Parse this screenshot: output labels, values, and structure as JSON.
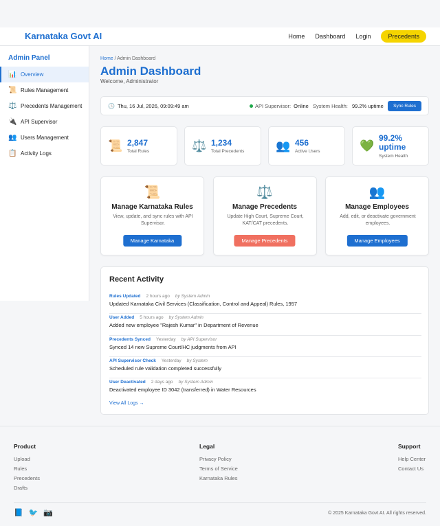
{
  "brand": "Karnataka Govt AI",
  "nav": {
    "links": [
      "Home",
      "Dashboard",
      "Login"
    ],
    "cta": "Precedents"
  },
  "sidebar": {
    "title": "Admin Panel",
    "items": [
      {
        "icon": "📊",
        "label": "Overview"
      },
      {
        "icon": "📜",
        "label": "Rules Management"
      },
      {
        "icon": "⚖️",
        "label": "Precedents Management"
      },
      {
        "icon": "🔌",
        "label": "API Supervisor"
      },
      {
        "icon": "👥",
        "label": "Users Management"
      },
      {
        "icon": "📋",
        "label": "Activity Logs"
      }
    ]
  },
  "breadcrumb": {
    "home": "Home",
    "sep": "/",
    "current": "Admin Dashboard"
  },
  "page": {
    "title": "Admin Dashboard",
    "welcome": "Welcome, Administrator"
  },
  "status": {
    "clock_icon": "🕒",
    "datetime": "Thu, 16 Jul, 2026, 09:09:49 am",
    "api_label": "API Supervisor:",
    "api_value": "Online",
    "health_label": "System Health:",
    "health_value": "99.2% uptime",
    "sync_label": "Sync Rules"
  },
  "stats": [
    {
      "icon": "📜",
      "value": "2,847",
      "label": "Total Rules"
    },
    {
      "icon": "⚖️",
      "value": "1,234",
      "label": "Total Precedents"
    },
    {
      "icon": "👥",
      "value": "456",
      "label": "Active Users"
    },
    {
      "icon": "💚",
      "value": "99.2% uptime",
      "label": "System Health"
    }
  ],
  "cards": [
    {
      "icon": "📜",
      "title": "Manage Karnataka Rules",
      "desc": "View, update, and sync rules with API Supervisor.",
      "button": "Manage Karnataka"
    },
    {
      "icon": "⚖️",
      "title": "Manage Precedents",
      "desc": "Update High Court, Supreme Court, KAT/CAT precedents.",
      "button": "Manage Precedents"
    },
    {
      "icon": "👥",
      "title": "Manage Employees",
      "desc": "Add, edit, or deactivate government employees.",
      "button": "Manage Employees"
    }
  ],
  "activity": {
    "title": "Recent Activity",
    "items": [
      {
        "type": "Rules Updated",
        "time": "2 hours ago",
        "by": "by System Admin",
        "desc": "Updated Karnataka Civil Services (Classification, Control and Appeal) Rules, 1957"
      },
      {
        "type": "User Added",
        "time": "5 hours ago",
        "by": "by System Admin",
        "desc": "Added new employee \"Rajesh Kumar\" in Department of Revenue"
      },
      {
        "type": "Precedents Synced",
        "time": "Yesterday",
        "by": "by API Supervisor",
        "desc": "Synced 14 new Supreme Court/HC judgments from API"
      },
      {
        "type": "API Supervisor Check",
        "time": "Yesterday",
        "by": "by System",
        "desc": "Scheduled rule validation completed successfully"
      },
      {
        "type": "User Deactivated",
        "time": "2 days ago",
        "by": "by System Admin",
        "desc": "Deactivated employee ID 3042 (transferred) in Water Resources"
      }
    ],
    "view_all": "View All Logs →"
  },
  "footer": {
    "product": {
      "title": "Product",
      "links": [
        "Upload",
        "Rules",
        "Precedents",
        "Drafts"
      ]
    },
    "legal": {
      "title": "Legal",
      "links": [
        "Privacy Policy",
        "Terms of Service",
        "Karnataka Rules"
      ]
    },
    "support": {
      "title": "Support",
      "links": [
        "Help Center",
        "Contact Us"
      ]
    },
    "socials": [
      "📘",
      "🐦",
      "📷"
    ],
    "copyright": "© 2025 Karnataka Govt AI. All rights reserved."
  }
}
